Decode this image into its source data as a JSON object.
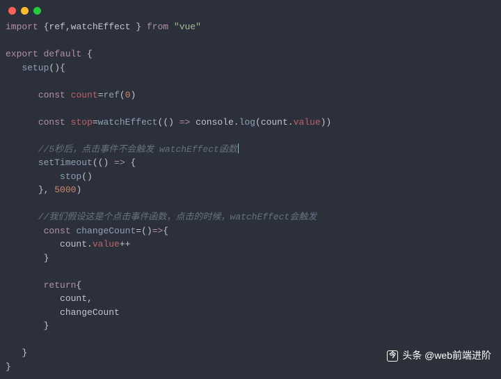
{
  "window": {
    "dot1": "red",
    "dot2": "yellow",
    "dot3": "green"
  },
  "code": {
    "l1_import": "import",
    "l1_brace_open": " {",
    "l1_ref": "ref",
    "l1_comma": ",",
    "l1_watch": "watchEffect",
    "l1_brace_close": " } ",
    "l1_from": "from",
    "l1_sp": " ",
    "l1_vue": "\"vue\"",
    "l3_export": "export",
    "l3_sp": " ",
    "l3_default": "default",
    "l3_brace": " {",
    "l4_indent": "   ",
    "l4_setup": "setup",
    "l4_paren": "(){",
    "l6_indent": "      ",
    "l6_const": "const",
    "l6_sp": " ",
    "l6_count": "count",
    "l6_eq": "=",
    "l6_reffn": "ref",
    "l6_open": "(",
    "l6_zero": "0",
    "l6_close": ")",
    "l8_indent": "      ",
    "l8_const": "const",
    "l8_sp": " ",
    "l8_stop": "stop",
    "l8_eq": "=",
    "l8_we": "watchEffect",
    "l8_open": "(",
    "l8_paren": "()",
    "l8_arrow": " => ",
    "l8_cons": "console",
    "l8_dot": ".",
    "l8_log": "log",
    "l8_open2": "(",
    "l8_count": "count",
    "l8_dot2": ".",
    "l8_value": "value",
    "l8_close2": "))",
    "l10_indent": "      ",
    "l10_cmt": "//5秒后，点击事件不会触发 watchEffect函数",
    "l11_indent": "      ",
    "l11_setTimeout": "setTimeout",
    "l11_open": "(",
    "l11_paren": "()",
    "l11_arrow": " => ",
    "l11_brace": "{",
    "l12_indent": "          ",
    "l12_stop": "stop",
    "l12_call": "()",
    "l13_indent": "      ",
    "l13_close": "}, ",
    "l13_num": "5000",
    "l13_close2": ")",
    "l15_indent": "      ",
    "l15_cmt": "//我们假设这是个点击事件函数，点击的时候，watchEffect会触发",
    "l16_indent": "       ",
    "l16_const": "const",
    "l16_sp": " ",
    "l16_cc": "changeCount",
    "l16_eq": "=",
    "l16_paren": "()",
    "l16_arrow": "=>",
    "l16_brace": "{",
    "l17_indent": "          ",
    "l17_count": "count",
    "l17_dot": ".",
    "l17_value": "value",
    "l17_inc": "++",
    "l18_indent": "       ",
    "l18_close": "}",
    "l20_indent": "       ",
    "l20_return": "return",
    "l20_brace": "{",
    "l21_indent": "          ",
    "l21_count": "count",
    "l21_comma": ",",
    "l22_indent": "          ",
    "l22_cc": "changeCount",
    "l23_indent": "       ",
    "l23_close": "}",
    "l25_indent": "   ",
    "l25_close": "}",
    "l26_close": "}"
  },
  "footer": {
    "prefix": "头条",
    "at": " @",
    "handle": "web前端进阶"
  }
}
